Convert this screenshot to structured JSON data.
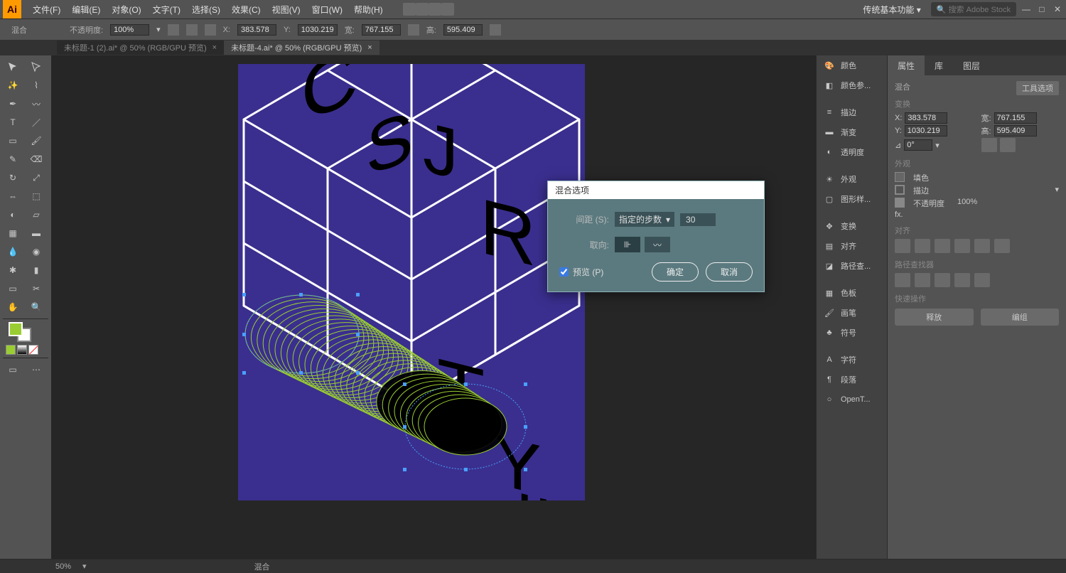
{
  "app": {
    "logo": "Ai"
  },
  "menubar": {
    "items": [
      "文件(F)",
      "编辑(E)",
      "对象(O)",
      "文字(T)",
      "选择(S)",
      "效果(C)",
      "视图(V)",
      "窗口(W)",
      "帮助(H)"
    ],
    "workspace_label": "传统基本功能",
    "search_placeholder": "搜索 Adobe Stock"
  },
  "optionsbar": {
    "mix_label": "混合",
    "opacity_label": "不透明度:",
    "opacity_value": "100%",
    "x_label": "X:",
    "x_value": "383.578",
    "y_label": "Y:",
    "y_value": "1030.219",
    "w_label": "宽:",
    "w_value": "767.155",
    "h_label": "高:",
    "h_value": "595.409"
  },
  "tabs": [
    {
      "label": "未标题-1 (2).ai* @ 50% (RGB/GPU 预览)",
      "active": false
    },
    {
      "label": "未标题-4.ai* @ 50% (RGB/GPU 预览)",
      "active": true
    }
  ],
  "panel_strip": {
    "groups": [
      [
        "颜色",
        "颜色参..."
      ],
      [
        "描边",
        "渐变",
        "透明度"
      ],
      [
        "外观",
        "图形样..."
      ],
      [
        "变换",
        "对齐",
        "路径查..."
      ],
      [
        "色板",
        "画笔",
        "符号"
      ],
      [
        "字符",
        "段落",
        "OpenT..."
      ]
    ]
  },
  "properties": {
    "tabs": [
      "属性",
      "库",
      "图层"
    ],
    "mix_label": "混合",
    "tool_options_btn": "工具选项",
    "transform": {
      "title": "变换",
      "x_l": "X:",
      "x": "383.578",
      "y_l": "Y:",
      "y": "1030.219",
      "w_l": "宽:",
      "w": "767.155",
      "h_l": "高:",
      "h": "595.409",
      "angle": "0°"
    },
    "appearance": {
      "title": "外观",
      "fill": "填色",
      "stroke": "描边",
      "opacity": "不透明度",
      "opacity_val": "100%",
      "fx": "fx."
    },
    "align": {
      "title": "对齐"
    },
    "pathfinder": {
      "title": "路径查找器"
    },
    "quick": {
      "title": "快速操作",
      "release": "释放",
      "group": "编组"
    }
  },
  "dialog": {
    "title": "混合选项",
    "spacing_label": "间距 (S):",
    "spacing_select": "指定的步数",
    "spacing_value": "30",
    "orient_label": "取向:",
    "preview_label": "预览 (P)",
    "ok": "确定",
    "cancel": "取消"
  },
  "status": {
    "zoom": "50%",
    "mode": "混合"
  }
}
